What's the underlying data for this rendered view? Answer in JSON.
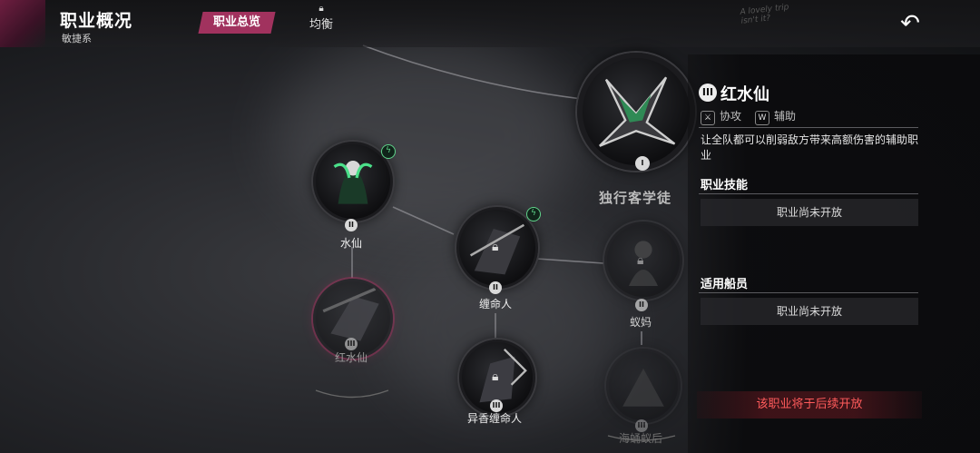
{
  "header": {
    "title": "职业概况",
    "subtitle": "敏捷系",
    "tabs": [
      {
        "label": "职业总览",
        "active": true
      },
      {
        "label": "均衡",
        "locked": true
      }
    ],
    "back_icon": "back-arrow-icon"
  },
  "tree": {
    "root_name": "独行客学徒",
    "root_rank": "I",
    "nodes": [
      {
        "name": "水仙",
        "rank": "II",
        "status": "unlocked",
        "boost": true
      },
      {
        "name": "红水仙",
        "rank": "III",
        "status": "selected"
      },
      {
        "name": "缠命人",
        "rank": "II",
        "status": "locked",
        "boost": true
      },
      {
        "name": "异香缠命人",
        "rank": "III",
        "status": "locked"
      },
      {
        "name": "蚁妈",
        "rank": "II",
        "status": "locked"
      },
      {
        "name": "海蛹蚁后",
        "rank": "III",
        "status": "locked"
      }
    ]
  },
  "panel": {
    "rank": "III",
    "title": "红水仙",
    "tags": [
      {
        "icon": "sword-icon",
        "label": "协攻"
      },
      {
        "icon": "support-icon",
        "label": "辅助"
      }
    ],
    "description": "让全队都可以削弱敌方带来高额伤害的辅助职业",
    "skills_title": "职业技能",
    "skills_value": "职业尚未开放",
    "crew_title": "适用船员",
    "crew_value": "职业尚未开放",
    "footer_notice": "该职业将于后续开放"
  },
  "colors": {
    "accent": "#a1325e",
    "boost": "#5fd38a",
    "notice": "#ff5b5b"
  }
}
